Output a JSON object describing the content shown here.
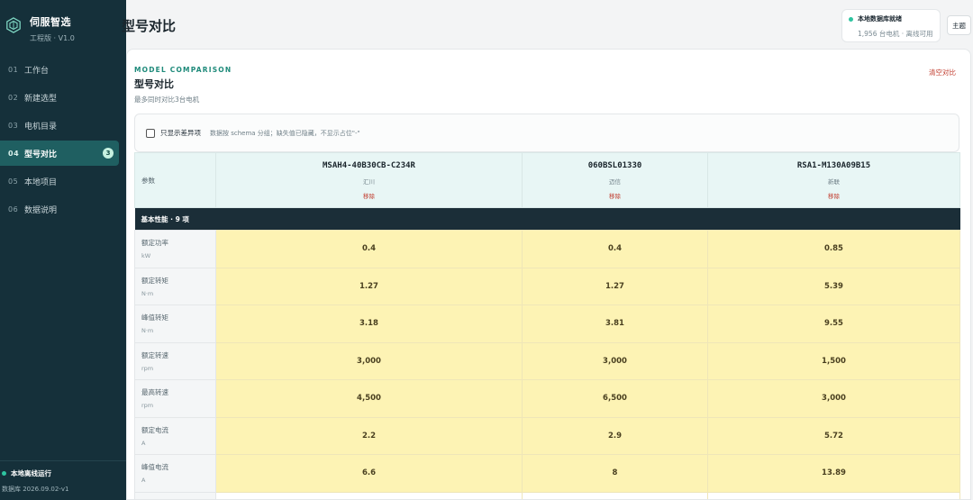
{
  "app": {
    "name": "伺服智选",
    "edition": "工程版 · V1.0"
  },
  "nav": [
    {
      "num": "01",
      "label": "工作台"
    },
    {
      "num": "02",
      "label": "新建选型"
    },
    {
      "num": "03",
      "label": "电机目录"
    },
    {
      "num": "04",
      "label": "型号对比",
      "badge": "3",
      "active": true
    },
    {
      "num": "05",
      "label": "本地项目"
    },
    {
      "num": "06",
      "label": "数据说明"
    }
  ],
  "footer": {
    "status": "本地离线运行",
    "db": "数据库 2026.09.02-v1"
  },
  "header": {
    "title": "型号对比",
    "status_title": "本地数据库就绪",
    "status_detail": "1,956 台电机 · 离线可用",
    "theme_label": "主题"
  },
  "section": {
    "kicker": "MODEL COMPARISON",
    "title": "型号对比",
    "subtitle": "最多同时对比3台电机",
    "clear_label": "清空对比"
  },
  "filter": {
    "checkbox_label": "只显示差异项",
    "hint": "数据按 schema 分组；缺失值已隐藏，不显示占位\"-\""
  },
  "table": {
    "param_header": "参数",
    "remove_label": "移除",
    "models": [
      {
        "name": "MSAH4-40B30CB-C234R",
        "brand": "汇川"
      },
      {
        "name": "060BSL01330",
        "brand": "迈信"
      },
      {
        "name": "RSA1-M130A09B15",
        "brand": "新联"
      }
    ],
    "group": {
      "label": "基本性能 · 9 项"
    },
    "rows": [
      {
        "name": "额定功率",
        "unit": "kW",
        "values": [
          "0.4",
          "0.4",
          "0.85"
        ]
      },
      {
        "name": "额定转矩",
        "unit": "N·m",
        "values": [
          "1.27",
          "1.27",
          "5.39"
        ]
      },
      {
        "name": "峰值转矩",
        "unit": "N·m",
        "values": [
          "3.18",
          "3.81",
          "9.55"
        ]
      },
      {
        "name": "额定转速",
        "unit": "rpm",
        "values": [
          "3,000",
          "3,000",
          "1,500"
        ]
      },
      {
        "name": "最高转速",
        "unit": "rpm",
        "values": [
          "4,500",
          "6,500",
          "3,000"
        ]
      },
      {
        "name": "额定电流",
        "unit": "A",
        "values": [
          "2.2",
          "2.9",
          "5.72"
        ]
      },
      {
        "name": "峰值电流",
        "unit": "A",
        "values": [
          "6.6",
          "8",
          "13.89"
        ]
      }
    ]
  }
}
